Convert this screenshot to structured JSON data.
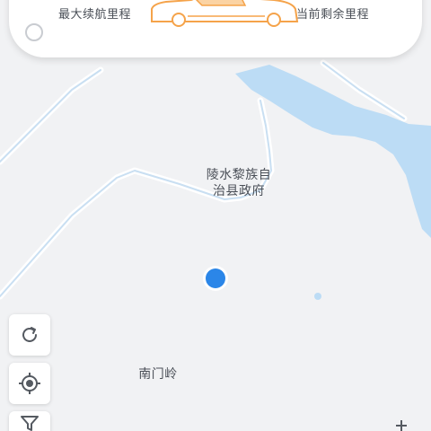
{
  "range_panel": {
    "max_range_label": "最大续航里程",
    "remaining_range_label": "当前剩余里程"
  },
  "map": {
    "labels": {
      "government_line1": "陵水黎族自",
      "government_line2": "治县政府",
      "nanmenling": "南门岭"
    },
    "colors": {
      "land": "#f1f2f4",
      "water": "#bcdcf5",
      "road": "#ffffff",
      "location_dot": "#2b86e8"
    }
  },
  "toolbar": {
    "refresh_icon": "refresh-icon",
    "locate_icon": "crosshair-icon",
    "filter_icon": "filter-icon"
  },
  "car_color": "#f5a34a"
}
